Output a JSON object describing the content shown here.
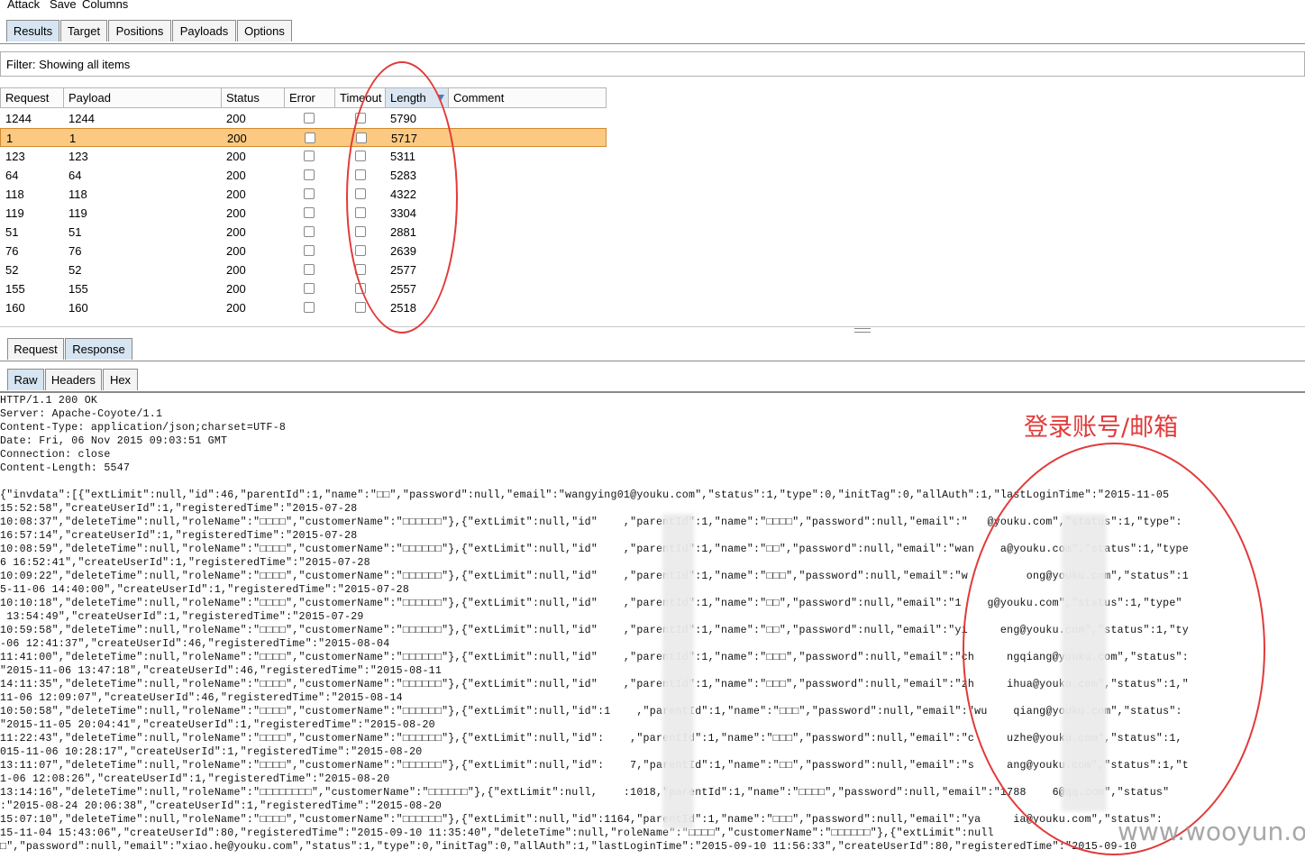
{
  "menu": [
    "Attack",
    "Save",
    "Columns"
  ],
  "top_tabs": [
    "Results",
    "Target",
    "Positions",
    "Payloads",
    "Options"
  ],
  "filter_text": "Filter: Showing all items",
  "table": {
    "columns": [
      "Request",
      "Payload",
      "Status",
      "Error",
      "Timeout",
      "Length",
      "Comment"
    ],
    "rows": [
      {
        "request": "1244",
        "payload": "1244",
        "status": "200",
        "length": "5790"
      },
      {
        "request": "1",
        "payload": "1",
        "status": "200",
        "length": "5717"
      },
      {
        "request": "123",
        "payload": "123",
        "status": "200",
        "length": "5311"
      },
      {
        "request": "64",
        "payload": "64",
        "status": "200",
        "length": "5283"
      },
      {
        "request": "118",
        "payload": "118",
        "status": "200",
        "length": "4322"
      },
      {
        "request": "119",
        "payload": "119",
        "status": "200",
        "length": "3304"
      },
      {
        "request": "51",
        "payload": "51",
        "status": "200",
        "length": "2881"
      },
      {
        "request": "76",
        "payload": "76",
        "status": "200",
        "length": "2639"
      },
      {
        "request": "52",
        "payload": "52",
        "status": "200",
        "length": "2577"
      },
      {
        "request": "155",
        "payload": "155",
        "status": "200",
        "length": "2557"
      },
      {
        "request": "160",
        "payload": "160",
        "status": "200",
        "length": "2518"
      }
    ]
  },
  "mid_tabs": [
    "Request",
    "Response"
  ],
  "low_tabs": [
    "Raw",
    "Headers",
    "Hex"
  ],
  "response_text": "HTTP/1.1 200 OK\nServer: Apache-Coyote/1.1\nContent-Type: application/json;charset=UTF-8\nDate: Fri, 06 Nov 2015 09:03:51 GMT\nConnection: close\nContent-Length: 5547\n\n{\"invdata\":[{\"extLimit\":null,\"id\":46,\"parentId\":1,\"name\":\"□□\",\"password\":null,\"email\":\"wangying01@youku.com\",\"status\":1,\"type\":0,\"initTag\":0,\"allAuth\":1,\"lastLoginTime\":\"2015-11-05\n15:52:58\",\"createUserId\":1,\"registeredTime\":\"2015-07-28\n10:08:37\",\"deleteTime\":null,\"roleName\":\"□□□□\",\"customerName\":\"□□□□□□\"},{\"extLimit\":null,\"id\"    ,\"parentId\":1,\"name\":\"□□□□\",\"password\":null,\"email\":\"   @youku.com\",\"status\":1,\"type\":\n16:57:14\",\"createUserId\":1,\"registeredTime\":\"2015-07-28\n10:08:59\",\"deleteTime\":null,\"roleName\":\"□□□□\",\"customerName\":\"□□□□□□\"},{\"extLimit\":null,\"id\"    ,\"parentId\":1,\"name\":\"□□\",\"password\":null,\"email\":\"wan    a@youku.com\",\"status\":1,\"type\n6 16:52:41\",\"createUserId\":1,\"registeredTime\":\"2015-07-28\n10:09:22\",\"deleteTime\":null,\"roleName\":\"□□□□\",\"customerName\":\"□□□□□□\"},{\"extLimit\":null,\"id\"    ,\"parentId\":1,\"name\":\"□□□\",\"password\":null,\"email\":\"w         ong@youku.com\",\"status\":1\n5-11-06 14:40:00\",\"createUserId\":1,\"registeredTime\":\"2015-07-28\n10:10:18\",\"deleteTime\":null,\"roleName\":\"□□□□\",\"customerName\":\"□□□□□□\"},{\"extLimit\":null,\"id\"    ,\"parentId\":1,\"name\":\"□□\",\"password\":null,\"email\":\"1    g@youku.com\",\"status\":1,\"type\"\n 13:54:49\",\"createUserId\":1,\"registeredTime\":\"2015-07-29\n10:59:58\",\"deleteTime\":null,\"roleName\":\"□□□□\",\"customerName\":\"□□□□□□\"},{\"extLimit\":null,\"id\"    ,\"parentId\":1,\"name\":\"□□\",\"password\":null,\"email\":\"yi     eng@youku.com\",\"status\":1,\"ty\n-06 12:41:37\",\"createUserId\":46,\"registeredTime\":\"2015-08-04\n11:41:00\",\"deleteTime\":null,\"roleName\":\"□□□□\",\"customerName\":\"□□□□□□\"},{\"extLimit\":null,\"id\"    ,\"parentId\":1,\"name\":\"□□□\",\"password\":null,\"email\":\"ch     ngqiang@youku.com\",\"status\":\n\"2015-11-06 13:47:18\",\"createUserId\":46,\"registeredTime\":\"2015-08-11\n14:11:35\",\"deleteTime\":null,\"roleName\":\"□□□□\",\"customerName\":\"□□□□□□\"},{\"extLimit\":null,\"id\"    ,\"parentId\":1,\"name\":\"□□□\",\"password\":null,\"email\":\"zh     ihua@youku.com\",\"status\":1,\"\n11-06 12:09:07\",\"createUserId\":46,\"registeredTime\":\"2015-08-14\n10:50:58\",\"deleteTime\":null,\"roleName\":\"□□□□\",\"customerName\":\"□□□□□□\"},{\"extLimit\":null,\"id\":1    ,\"parentId\":1,\"name\":\"□□□\",\"password\":null,\"email\":\"wu    qiang@youku.com\",\"status\":\n\"2015-11-05 20:04:41\",\"createUserId\":1,\"registeredTime\":\"2015-08-20\n11:22:43\",\"deleteTime\":null,\"roleName\":\"□□□□\",\"customerName\":\"□□□□□□\"},{\"extLimit\":null,\"id\":    ,\"parentId\":1,\"name\":\"□□□\",\"password\":null,\"email\":\"c     uzhe@youku.com\",\"status\":1,\n015-11-06 10:28:17\",\"createUserId\":1,\"registeredTime\":\"2015-08-20\n13:11:07\",\"deleteTime\":null,\"roleName\":\"□□□□\",\"customerName\":\"□□□□□□\"},{\"extLimit\":null,\"id\":    7,\"parentId\":1,\"name\":\"□□\",\"password\":null,\"email\":\"s     ang@youku.com\",\"status\":1,\"t\n1-06 12:08:26\",\"createUserId\":1,\"registeredTime\":\"2015-08-20\n13:14:16\",\"deleteTime\":null,\"roleName\":\"□□□□□□□□\",\"customerName\":\"□□□□□□\"},{\"extLimit\":null,    :1018,\"parentId\":1,\"name\":\"□□□□\",\"password\":null,\"email\":\"1788    6@qq.com\",\"status\"\n:\"2015-08-24 20:06:38\",\"createUserId\":1,\"registeredTime\":\"2015-08-20\n15:07:10\",\"deleteTime\":null,\"roleName\":\"□□□□\",\"customerName\":\"□□□□□□\"},{\"extLimit\":null,\"id\":1164,\"parentId\":1,\"name\":\"□□□\",\"password\":null,\"email\":\"ya     ia@youku.com\",\"status\":\n15-11-04 15:43:06\",\"createUserId\":80,\"registeredTime\":\"2015-09-10 11:35:40\",\"deleteTime\":null,\"roleName\":\"□□□□\",\"customerName\":\"□□□□□□\"},{\"extLimit\":null\n□\",\"password\":null,\"email\":\"xiao.he@youku.com\",\"status\":1,\"type\":0,\"initTag\":0,\"allAuth\":1,\"lastLoginTime\":\"2015-09-10 11:56:33\",\"createUserId\":80,\"registeredTime\":\"2015-09-10",
  "annotation": "登录账号/邮箱",
  "watermark": "www.wooyun.org",
  "colors": {
    "annotation_red": "#e23a3a",
    "selected_row": "#fbc982",
    "active_tab": "#d6e5f1"
  }
}
